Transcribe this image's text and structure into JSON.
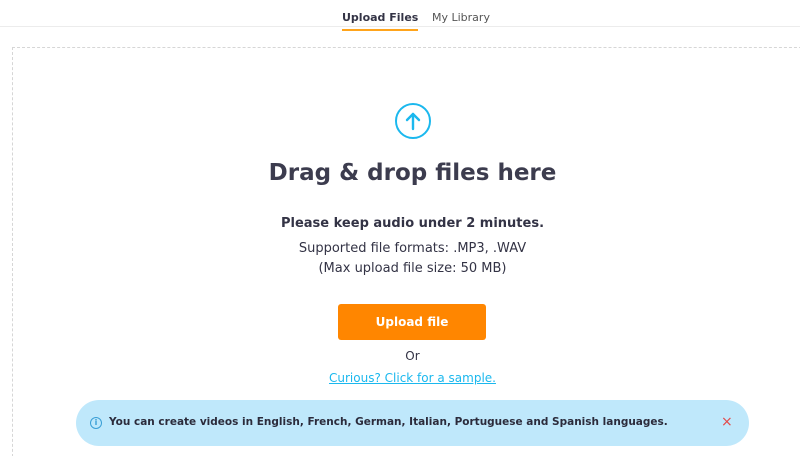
{
  "tabs": [
    {
      "label": "Upload Files",
      "active": true
    },
    {
      "label": "My Library",
      "active": false
    }
  ],
  "dropzone": {
    "icon": "upload-arrow-icon",
    "title": "Drag & drop files here",
    "note": "Please keep audio under 2 minutes.",
    "formats": "Supported file formats: .MP3, .WAV",
    "max_size": "(Max upload file size: 50 MB)",
    "upload_button": "Upload file",
    "or_text": "Or",
    "sample_link": "Curious? Click for a sample."
  },
  "banner": {
    "icon": "info-icon",
    "info_glyph": "i",
    "text": "You can create videos in English, French, German, Italian, Portuguese and Spanish languages.",
    "close_glyph": "×"
  },
  "colors": {
    "accent_orange": "#ff8600",
    "tab_underline": "#ffa41b",
    "link_blue": "#1bb8ee",
    "banner_bg": "#bfe8fb",
    "close_red": "#e34a4a"
  }
}
